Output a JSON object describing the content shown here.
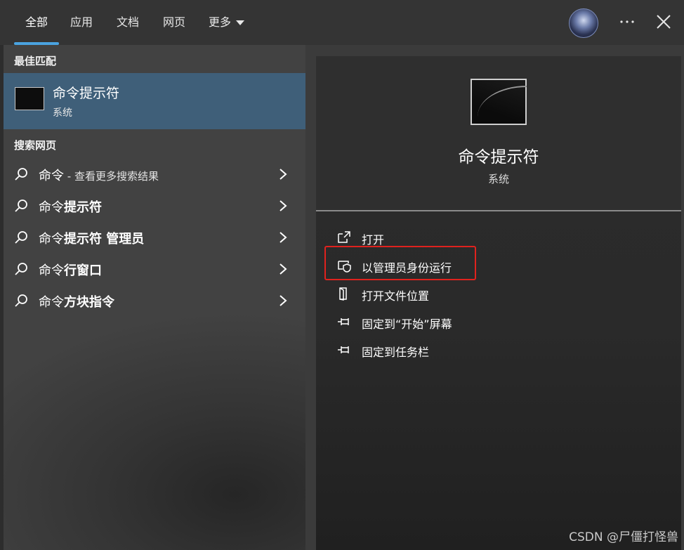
{
  "tabs": [
    {
      "label": "全部",
      "active": true
    },
    {
      "label": "应用"
    },
    {
      "label": "文档"
    },
    {
      "label": "网页"
    },
    {
      "label": "更多"
    }
  ],
  "sections": {
    "best_match": "最佳匹配",
    "search_web": "搜索网页"
  },
  "best_match": {
    "title": "命令提示符",
    "subtitle": "系统"
  },
  "web_results": [
    {
      "query": "命令",
      "bold": "",
      "suffix": " - 查看更多搜索结果"
    },
    {
      "query": "命令",
      "bold": "提示符",
      "suffix": ""
    },
    {
      "query": "命令",
      "bold": "提示符 管理员",
      "suffix": ""
    },
    {
      "query": "命令",
      "bold": "行窗口",
      "suffix": ""
    },
    {
      "query": "命令",
      "bold": "方块指令",
      "suffix": ""
    }
  ],
  "preview": {
    "title": "命令提示符",
    "subtitle": "系统",
    "actions": [
      {
        "label": "打开",
        "icon": "open-icon"
      },
      {
        "label": "以管理员身份运行",
        "icon": "shield-icon"
      },
      {
        "label": "打开文件位置",
        "icon": "folder-location-icon"
      },
      {
        "label": "固定到“开始”屏幕",
        "icon": "pin-icon"
      },
      {
        "label": "固定到任务栏",
        "icon": "pin-icon"
      }
    ]
  },
  "watermark": "CSDN @尸僵打怪兽",
  "colors": {
    "accent": "#4aa3e0",
    "selection": "#3f5f79",
    "highlight_box": "#e0221e"
  }
}
